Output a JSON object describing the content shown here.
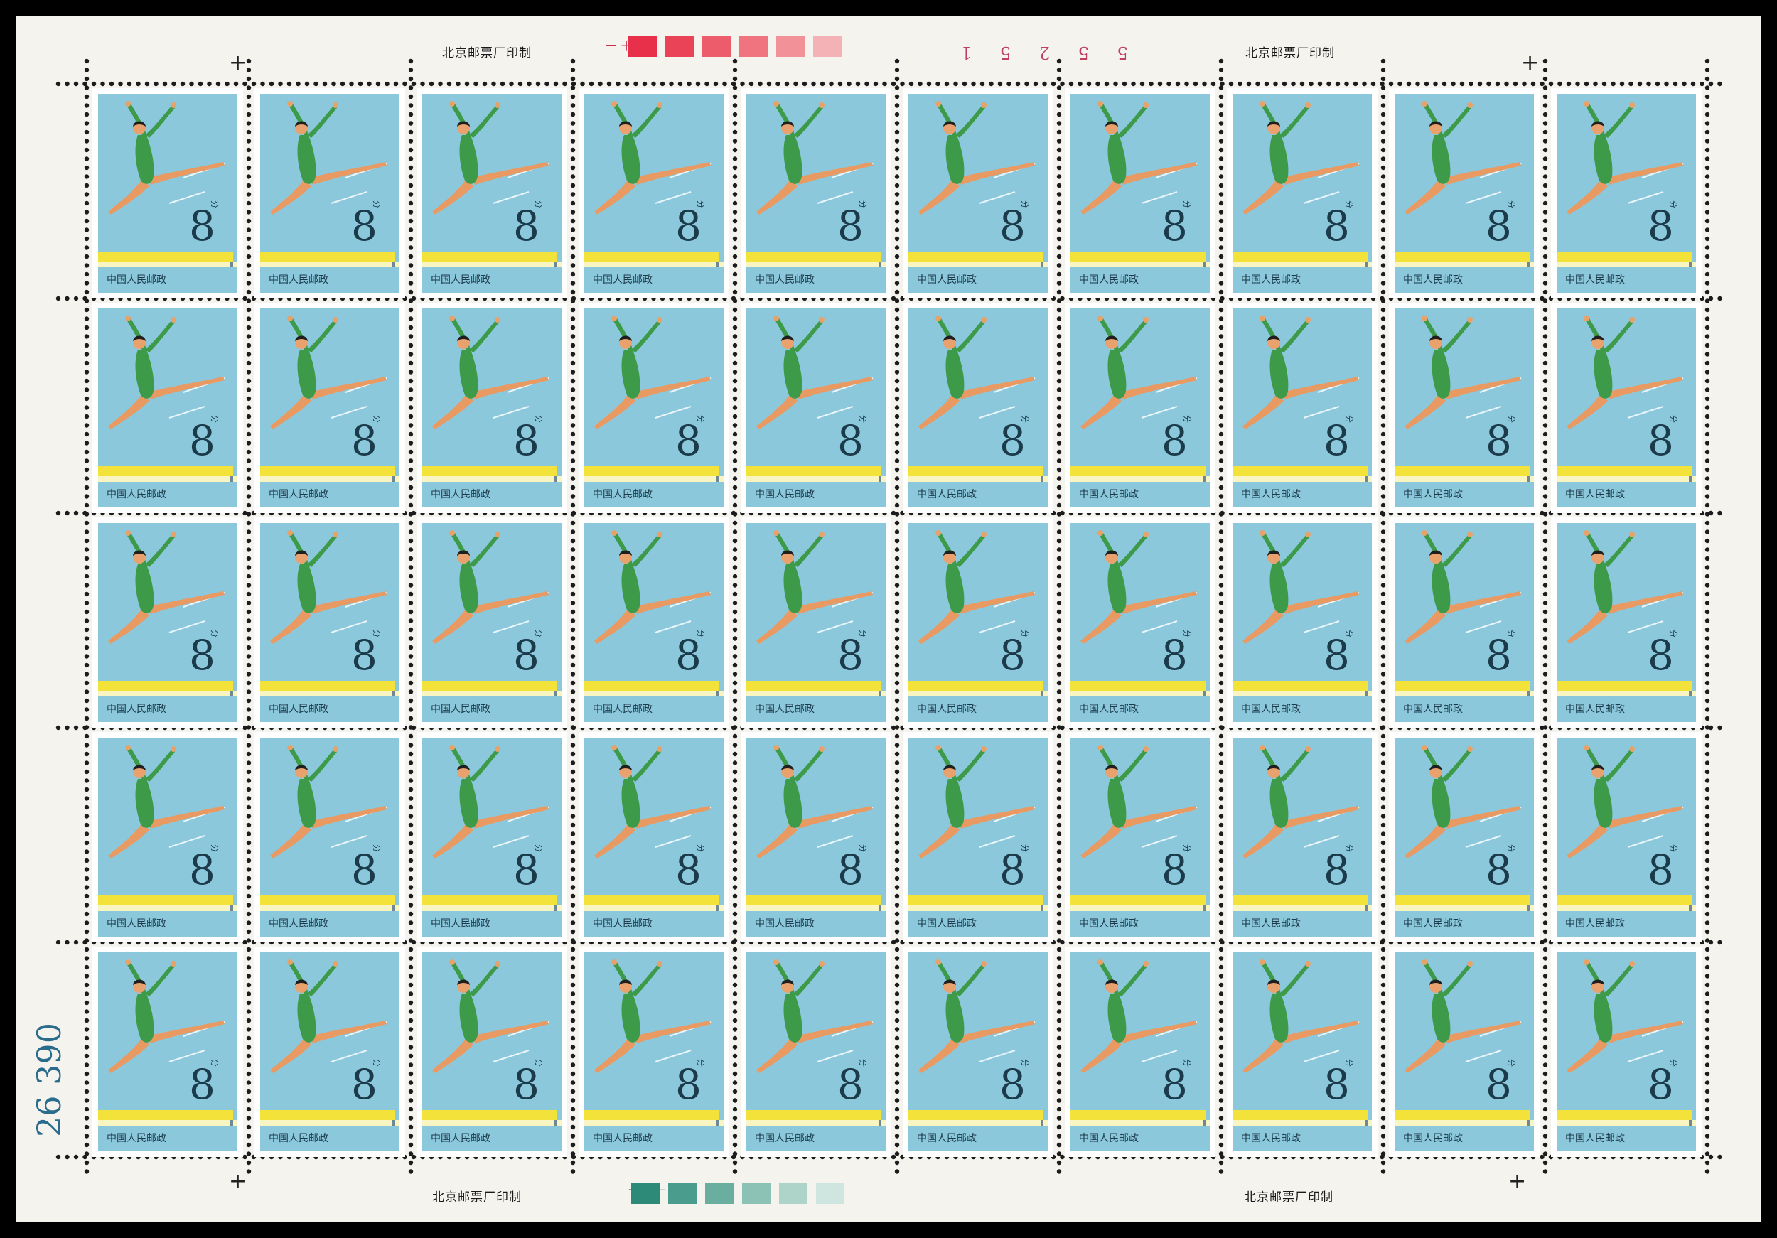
{
  "sheet": {
    "imprint_text": "北京邮票厂印制",
    "plate_number": "5 5 2 5 1",
    "serial_number": "26 390",
    "top_marginal_mark": "一 十一",
    "bottom_marginal_mark": "十 十一",
    "top_color_swatches": [
      "#e8304a",
      "#ea4358",
      "#ec5c6a",
      "#ef7480",
      "#f29298",
      "#f5b2b6"
    ],
    "bottom_color_swatches": [
      "#2e8a78",
      "#4a9c8c",
      "#6aaea0",
      "#8cc2b6",
      "#aed4ca",
      "#cfe6e0"
    ],
    "stamp_layout": {
      "rows": 5,
      "columns": 10
    }
  },
  "stamp": {
    "country": "中国人民邮政",
    "denomination": "8",
    "denomination_unit": "分",
    "colors": {
      "sky": "#8cc8dc",
      "leotard": "#3d9a49",
      "beam": "#f2e23a",
      "beam_edge": "#f8f5c2",
      "text": "#1b3a4a"
    }
  }
}
